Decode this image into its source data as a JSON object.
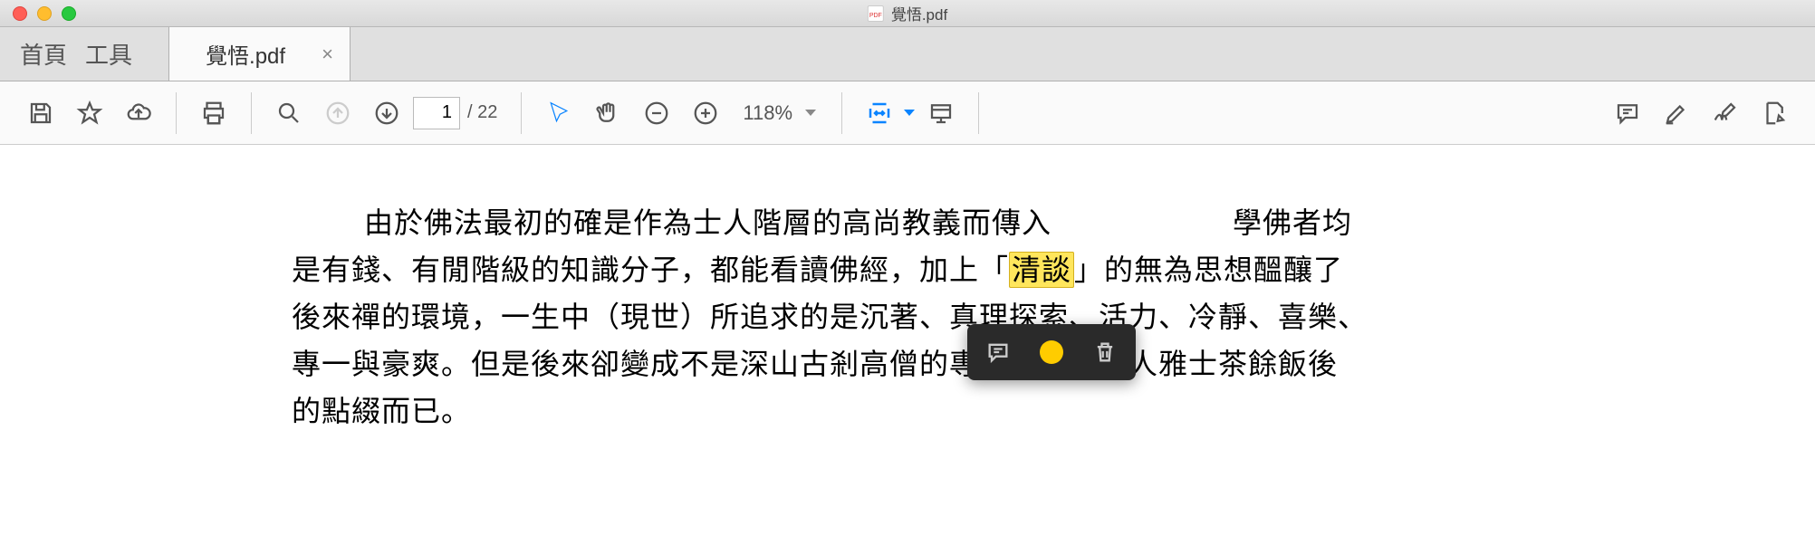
{
  "window": {
    "title": "覺悟.pdf"
  },
  "tabbar": {
    "home": "首頁",
    "tools": "工具",
    "active_tab": "覺悟.pdf"
  },
  "toolbar": {
    "current_page": "1",
    "page_sep": "/",
    "total_pages": "22",
    "zoom": "118%"
  },
  "document": {
    "line1_a": "由於佛法最初的確是作為士人階層的高尚教義而傳入",
    "line1_b": "學佛者均",
    "line2_a": "是有錢、有閒階級的知識分子，都能看讀佛經，加上「",
    "highlight": "清談",
    "line2_b": "」的無為思想醞釀了",
    "line3": "後來禪的環境，一生中（現世）所追求的是沉著、真理探索、活力、冷靜、喜樂、",
    "line4": "專一與豪爽。但是後來卻變成不是深山古剎高僧的專利，便是文人雅士茶餘飯後",
    "line5": "的點綴而已。"
  }
}
